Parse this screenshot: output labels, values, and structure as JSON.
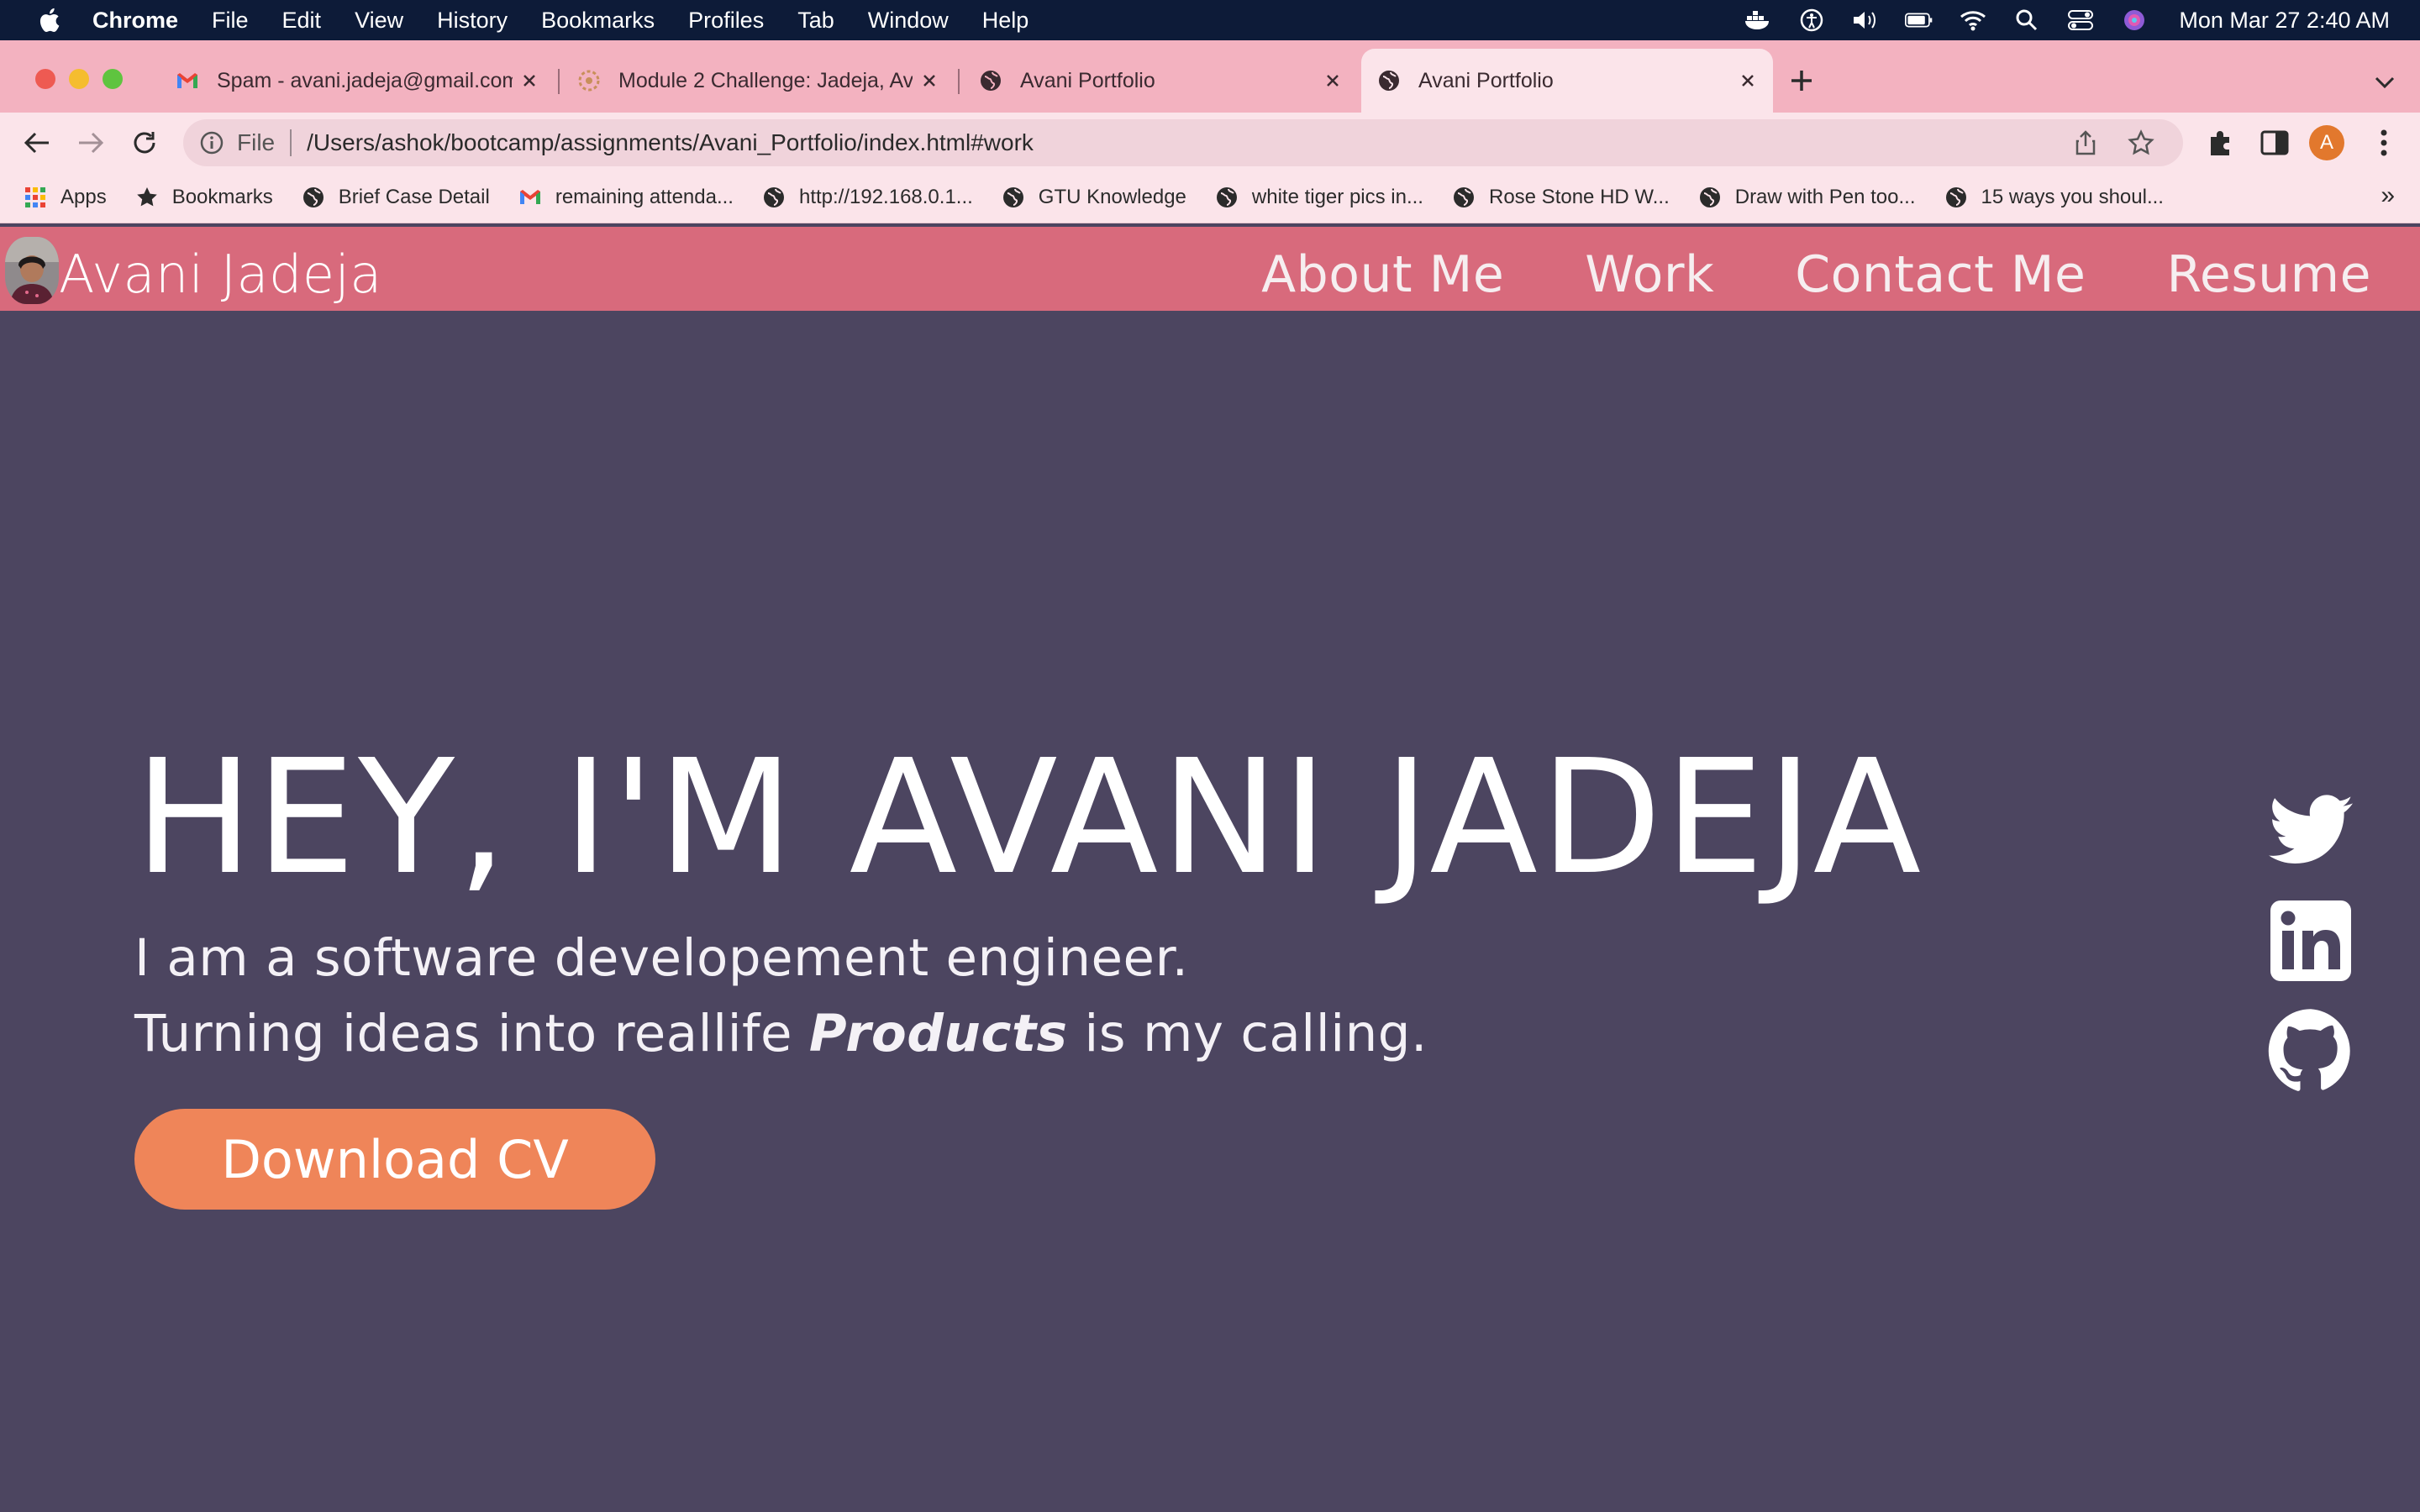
{
  "menubar": {
    "app_name": "Chrome",
    "items": [
      "File",
      "Edit",
      "View",
      "History",
      "Bookmarks",
      "Profiles",
      "Tab",
      "Window",
      "Help"
    ],
    "clock": "Mon Mar 27  2:40 AM"
  },
  "tabs": [
    {
      "title": "Spam - avani.jadeja@gmail.com",
      "icon": "gmail-icon",
      "active": false
    },
    {
      "title": "Module 2 Challenge: Jadeja, Av",
      "icon": "canvas-icon",
      "active": false
    },
    {
      "title": "Avani Portfolio",
      "icon": "globe-icon",
      "active": false
    },
    {
      "title": "Avani Portfolio",
      "icon": "globe-icon",
      "active": true
    }
  ],
  "omnibox": {
    "scheme": "File",
    "url": "/Users/ashok/bootcamp/assignments/Avani_Portfolio/index.html#work"
  },
  "profile_initial": "A",
  "bookmarks": [
    {
      "label": "Apps",
      "icon": "apps-grid-icon"
    },
    {
      "label": "Bookmarks",
      "icon": "star-icon"
    },
    {
      "label": "Brief Case Detail",
      "icon": "globe-icon"
    },
    {
      "label": "remaining attenda...",
      "icon": "gmail-icon"
    },
    {
      "label": "http://192.168.0.1...",
      "icon": "globe-icon"
    },
    {
      "label": "GTU Knowledge",
      "icon": "globe-icon"
    },
    {
      "label": "white tiger pics in...",
      "icon": "globe-icon"
    },
    {
      "label": "Rose Stone HD W...",
      "icon": "globe-icon"
    },
    {
      "label": "Draw with Pen too...",
      "icon": "globe-icon"
    },
    {
      "label": "15 ways you shoul...",
      "icon": "globe-icon"
    }
  ],
  "bookmarks_more": "»",
  "site": {
    "name": "Avani Jadeja",
    "nav": [
      "About Me",
      "Work",
      "Contact Me",
      "Resume"
    ],
    "hero_title": "HEY, I'M AVANI JADEJA",
    "line1": "I am a software developement engineer.",
    "line2_pre": "Turning ideas into reallife ",
    "line2_emph": "Products",
    "line2_post": " is my calling.",
    "cv_label": "Download CV",
    "social": [
      "twitter-icon",
      "linkedin-icon",
      "github-icon"
    ]
  },
  "colors": {
    "menubar": "#0d1b38",
    "tabstrip": "#f3b2c0",
    "toolbar": "#fbe4ea",
    "site_header": "#d86a7c",
    "page_bg": "#4c4560",
    "cv_button": "#ef8559"
  }
}
